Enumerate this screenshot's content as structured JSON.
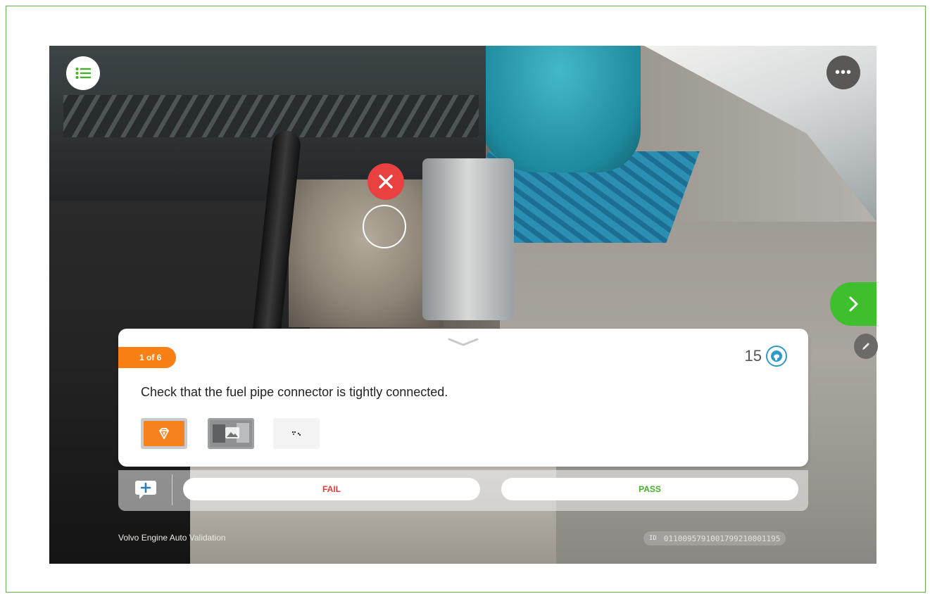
{
  "overlay": {
    "menu_icon": "list-icon",
    "more_icon": "more-horizontal-icon",
    "more_label": "•••",
    "marker_icon": "close-icon",
    "next_icon": "chevron-right-icon",
    "edit_icon": "pencil-icon"
  },
  "task": {
    "step_badge": "1 of 6",
    "score": "15",
    "score_icon": "brain-icon",
    "question": "Check that the fuel pipe connector is tightly connected.",
    "thumbnails": [
      "ar-marker-thumbnail",
      "image-thumbnail",
      "point-cloud-thumbnail"
    ]
  },
  "actions": {
    "comment_icon": "add-comment-icon",
    "fail_label": "FAIL",
    "pass_label": "PASS"
  },
  "footer": {
    "app_name": "Volvo Engine Auto Validation",
    "id_label": "ID",
    "id_value": "01100957910017992100011​95"
  },
  "colors": {
    "accent_orange": "#f77f14",
    "pass_green": "#43b02a",
    "fail_red": "#e53935",
    "frame_green": "#63b346"
  }
}
